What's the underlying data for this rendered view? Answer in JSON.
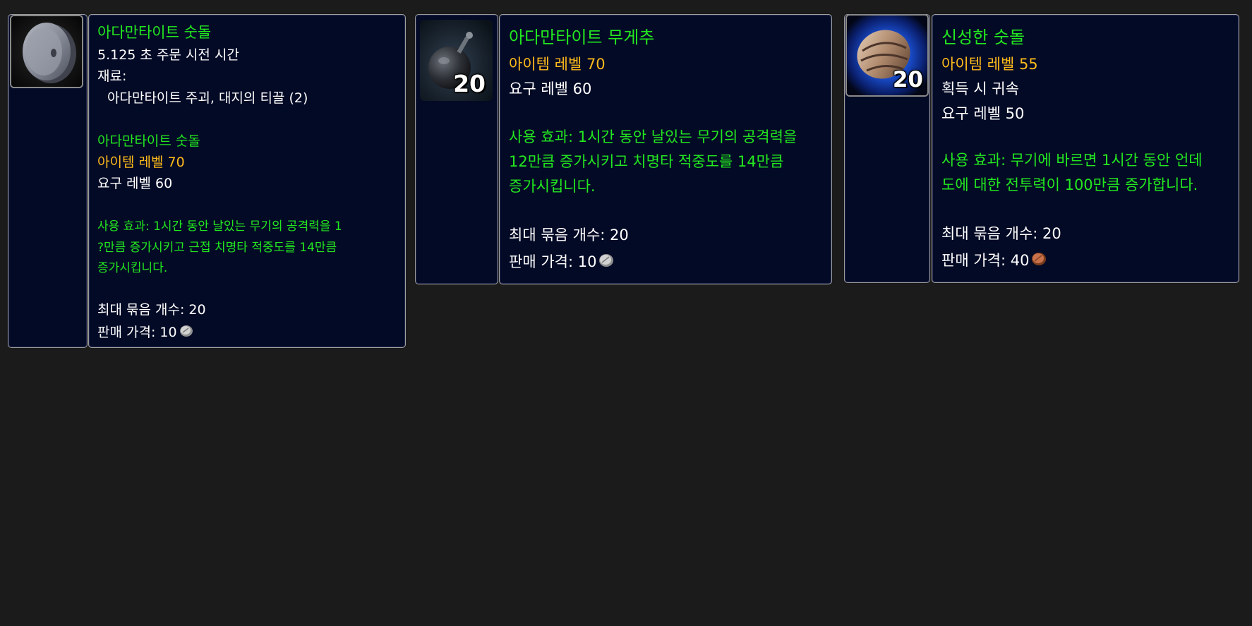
{
  "tooltips": [
    {
      "icon": "adamantite-sharpening-stone-icon",
      "stack": "",
      "name": "아다만타이트 숫돌",
      "cast_time": "5.125 초 주문 시전 시간",
      "reagents_label": "재료:",
      "reagents": "아다만타이트 주괴, 대지의 티끌 (2)",
      "created_name": "아다만타이트 숫돌",
      "item_level": "아이템 레벨 70",
      "required_level": "요구 레벨 60",
      "use_effect_1": "사용 효과: 1시간 동안 날있는 무기의 공격력을 1",
      "use_effect_2": "?만큼 증가시키고 근접 치명타 적중도를 14만큼",
      "use_effect_3": "증가시킵니다.",
      "max_stack": "최대 묶음 개수: 20",
      "sell_price": "판매 가격: 10",
      "coin": "silver-coin-icon"
    },
    {
      "icon": "weightstone-bomb-icon",
      "stack": "20",
      "name": "아다만타이트 무게추",
      "item_level": "아이템 레벨 70",
      "required_level": "요구 레벨 60",
      "use_effect_1": "사용 효과: 1시간 동안 날있는 무기의 공격력을",
      "use_effect_2": "12만큼 증가시키고 치명타 적중도를 14만큼",
      "use_effect_3": "증가시킵니다.",
      "max_stack": "최대 묶음 개수: 20",
      "sell_price": "판매 가격: 10",
      "coin": "silver-coin-icon"
    },
    {
      "icon": "blessed-stone-icon",
      "stack": "20",
      "name": "신성한 숫돌",
      "item_level": "아이템 레벨 55",
      "binding": "획득 시 귀속",
      "required_level": "요구 레벨 50",
      "use_effect_1": "사용 효과: 무기에 바르면 1시간 동안 언데",
      "use_effect_2": "도에 대한 전투력이 100만큼 증가합니다.",
      "max_stack": "최대 묶음 개수: 20",
      "sell_price": "판매 가격: 40",
      "coin": "copper-coin-icon"
    }
  ],
  "colors": {
    "background": "#1b1b1b",
    "panel": "#030a26",
    "border": "#a0a0a0",
    "item_name": "#23e81f",
    "item_level": "#ffbb1a",
    "text": "#ffffff",
    "use_effect": "#23e81f"
  }
}
